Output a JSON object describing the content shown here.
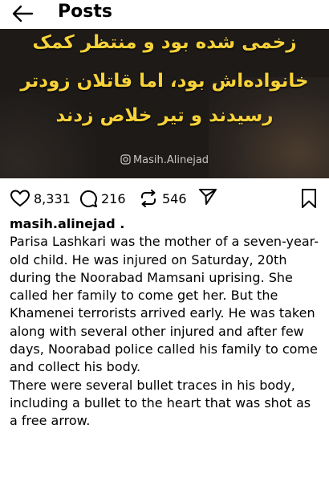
{
  "header": {
    "title": "Posts"
  },
  "post": {
    "image_text": {
      "line1": "زخمی شده بود و منتظر کمک",
      "line2": "خانواده‌اش بود، اما قاتلان زودتر",
      "line3": "رسیدند و تیر خلاص زدند"
    },
    "watermark": "Masih.Alinejad",
    "likes": "8,331",
    "comments": "216",
    "reposts": "546",
    "username": "masih.alinejad .",
    "caption_p1": "Parisa Lashkari was the mother of a seven-year-old child. He was injured on Saturday, 20th during the Noorabad Mamsani uprising. She called her family to come get her. But the Khamenei terrorists arrived early. He was taken along with several other injured and after few days, Noorabad police called his family to come and collect his body.",
    "caption_p2": "There were several bullet traces in his body, including a bullet to the heart that was shot as a free arrow."
  },
  "icons": {
    "back": "back-arrow-icon",
    "like": "heart-icon",
    "comment": "comment-bubble-icon",
    "repost": "repost-icon",
    "share": "send-icon",
    "save": "bookmark-icon"
  },
  "colors": {
    "image_text": "#f7d23a",
    "image_bg": "#1d1a18"
  }
}
